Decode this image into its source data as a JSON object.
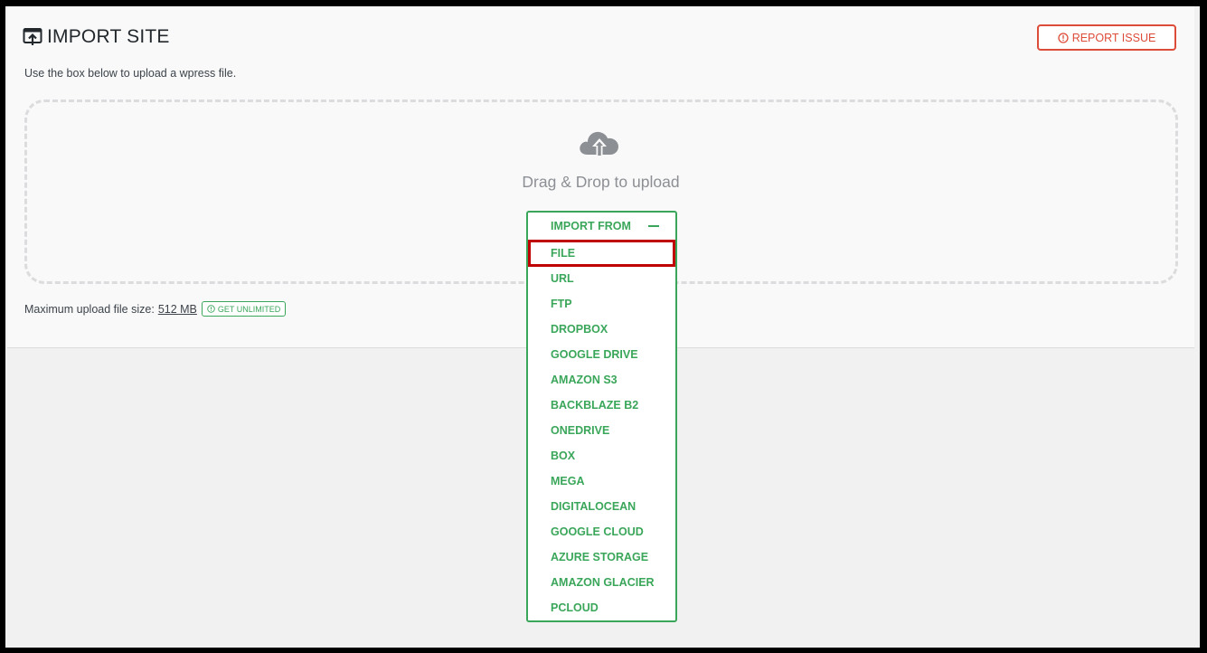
{
  "header": {
    "title": "IMPORT SITE",
    "title_icon": "import-site-icon",
    "report_issue_label": "REPORT ISSUE"
  },
  "description": "Use the box below to upload a wpress file.",
  "dropzone": {
    "icon": "cloud-upload-icon",
    "text": "Drag & Drop to upload"
  },
  "upload_limit": {
    "label": "Maximum upload file size:",
    "size": "512 MB",
    "button_label": "GET UNLIMITED"
  },
  "import_menu": {
    "header": "IMPORT FROM",
    "items": [
      {
        "label": "FILE",
        "highlighted": true
      },
      {
        "label": "URL"
      },
      {
        "label": "FTP"
      },
      {
        "label": "DROPBOX"
      },
      {
        "label": "GOOGLE DRIVE"
      },
      {
        "label": "AMAZON S3"
      },
      {
        "label": "BACKBLAZE B2"
      },
      {
        "label": "ONEDRIVE"
      },
      {
        "label": "BOX"
      },
      {
        "label": "MEGA"
      },
      {
        "label": "DIGITALOCEAN"
      },
      {
        "label": "GOOGLE CLOUD"
      },
      {
        "label": "AZURE STORAGE"
      },
      {
        "label": "AMAZON GLACIER"
      },
      {
        "label": "PCLOUD"
      }
    ]
  },
  "colors": {
    "accent_green": "#3aa65a",
    "report_red": "#dd4b39",
    "highlight_red": "#c00000"
  }
}
